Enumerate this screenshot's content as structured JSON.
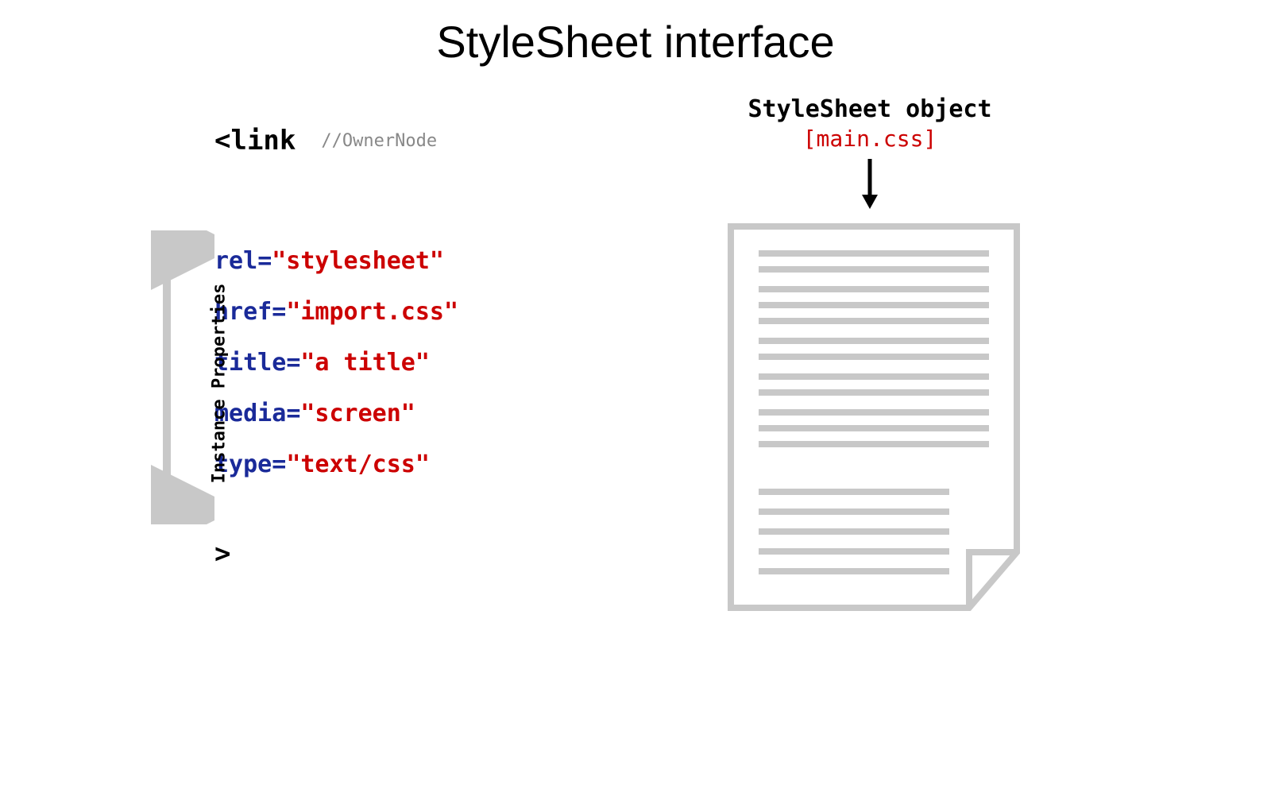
{
  "title": "StyleSheet interface",
  "link_tag_open": "<link",
  "owner_comment": "//OwnerNode",
  "bracket_label": "Instance Properties",
  "attributes": [
    {
      "name": "rel",
      "value": "\"stylesheet\""
    },
    {
      "name": "href",
      "value": "\"import.css\""
    },
    {
      "name": "title",
      "value": "\"a title\""
    },
    {
      "name": "media",
      "value": "\"screen\""
    },
    {
      "name": "type",
      "value": "\"text/css\""
    }
  ],
  "link_tag_close": ">",
  "object_heading": "StyleSheet object",
  "object_filename": "[main.css]"
}
